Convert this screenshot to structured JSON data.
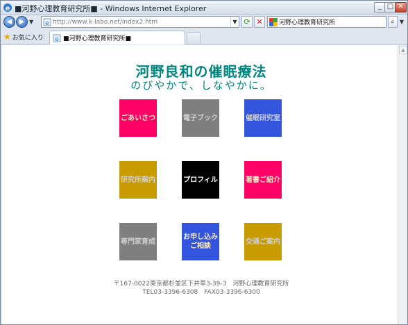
{
  "window": {
    "title": "■河野心理教育研究所■ - Windows Internet Explorer",
    "minimize": "_",
    "maximize": "□",
    "close": "✕"
  },
  "nav": {
    "back_icon": "back-arrow-icon",
    "forward_icon": "forward-arrow-icon",
    "address": "http://www.k-labo.net/index2.htm",
    "refresh_icon": "refresh-icon",
    "stop_icon": "stop-icon",
    "search_value": "河野心理教育研究所",
    "search_icon": "magnifier-icon"
  },
  "tabs": {
    "favorites_label": "お気に入り",
    "active_tab": "■河野心理教育研究所■"
  },
  "page": {
    "title": "河野良和の催眠療法",
    "tagline": "のびやかで、しなやかに。",
    "tiles": [
      {
        "label": "ごあいさつ",
        "color": "#ff0066"
      },
      {
        "label": "電子ブック",
        "color": "#7f7f7f"
      },
      {
        "label": "催眠研究室",
        "color": "#3355dd"
      },
      {
        "label": "研究所案内",
        "color": "#c89b00"
      },
      {
        "label": "プロフィル",
        "color": "#000000"
      },
      {
        "label": "著書ご紹介",
        "color": "#ff0066"
      },
      {
        "label": "専門家育成",
        "color": "#7f7f7f"
      },
      {
        "label": "お申し込み\nご相談",
        "color": "#3355dd"
      },
      {
        "label": "交通ご案内",
        "color": "#c89b00"
      }
    ],
    "footer_line1": "〒167-0022東京都杉並区下井草3-39-3　河野心理教育研究所",
    "footer_line2": "TEL03-3396-6308　FAX03-3396-6300"
  }
}
